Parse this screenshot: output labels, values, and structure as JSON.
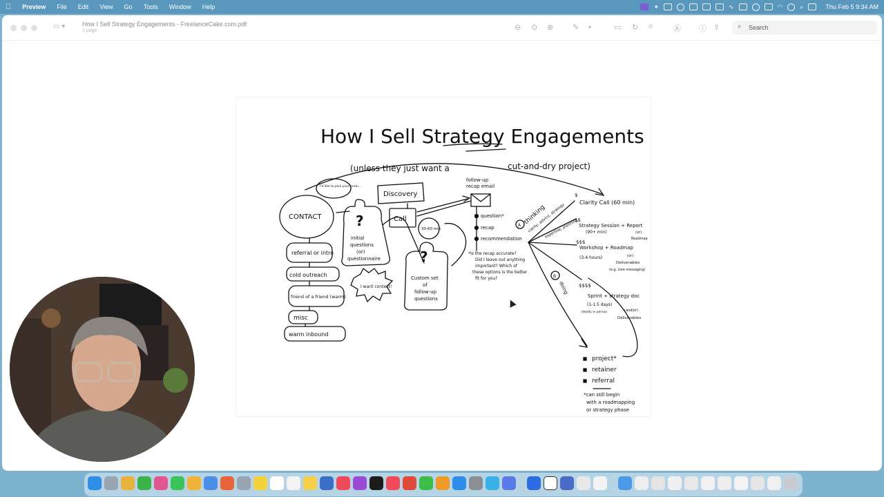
{
  "menubar": {
    "apple": "",
    "app": "Preview",
    "menus": [
      "File",
      "Edit",
      "View",
      "Go",
      "Tools",
      "Window",
      "Help"
    ],
    "clock": "Thu Feb 5  9:34 AM"
  },
  "window": {
    "title": "How I Sell Strategy Engagements - FreelanceCake.com.pdf",
    "subtitle": "1 page",
    "search_placeholder": "Search"
  },
  "document": {
    "title": "How I Sell Strategy Engagements",
    "subtitle_left": "(unless they just want a",
    "subtitle_right": "cut-and-dry project)",
    "bubble": "I'd like to pick your brain...",
    "contact": "CONTACT",
    "sources": [
      "referral or intro",
      "cold outreach",
      "friend of a friend (warm)",
      "misc",
      "warm inbound"
    ],
    "initial": [
      "initial",
      "questions",
      "(or)",
      "questionnaire"
    ],
    "discovery": "Discovery",
    "call": "Call",
    "call_time": "30-60 min",
    "i_want_context": "I want context!",
    "custom_set": [
      "Custom set",
      "of",
      "follow-up",
      "questions"
    ],
    "followup_email": [
      "follow-up",
      "recap email"
    ],
    "timeline": [
      "question*",
      "recap",
      "recommendation"
    ],
    "note": [
      "*Is the recap accurate?",
      "Did I leave out anything",
      "important? Which of",
      "these options is the better",
      "fit for you?"
    ],
    "thinking_label": "thinking",
    "thinking_sub": "clarity, advice, strategy",
    "expertise": "expertise, planning",
    "doing_label": "doing",
    "circle_a": "A",
    "circle_b": "B",
    "offers": [
      {
        "price": "$",
        "text": "Clarity Call (60 min)"
      },
      {
        "price": "$$",
        "text": "Strategy Session + Report",
        "sub": "(90+ min)",
        "sub2": "(or)",
        "sub3": "Roadmap"
      },
      {
        "price": "$$$",
        "text": "Workshop + Roadmap",
        "sub": "(3-4 hours)",
        "sub2": "(or)",
        "sub3": "Deliverables",
        "sub4": "(e.g. core messaging)"
      },
      {
        "price": "$$$$",
        "text": "Sprint + strategy doc",
        "sub": "(1-1.5 days)",
        "sub2": "(and/or)",
        "sub3": "ideally in person",
        "sub4": "Deliverables"
      }
    ],
    "doing_items": [
      "project*",
      "retainer",
      "referral"
    ],
    "footnote": [
      "*can still begin",
      "with a roadmapping",
      "or strategy phase"
    ]
  }
}
